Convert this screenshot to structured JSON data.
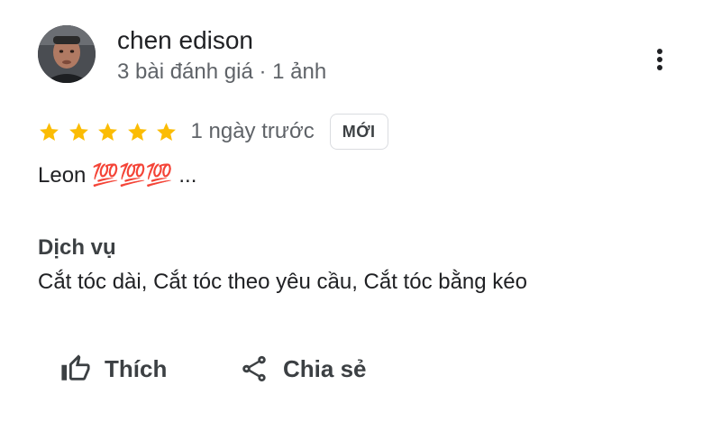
{
  "review": {
    "author": {
      "name": "chen edison",
      "meta": "3 bài đánh giá · 1 ảnh"
    },
    "rating": 5,
    "rating_max": 5,
    "date": "1 ngày trước",
    "badge": "MỚI",
    "text": "Leon 💯💯💯 ...",
    "services": {
      "heading": "Dịch vụ",
      "value": "Cắt tóc dài, Cắt tóc theo yêu cầu, Cắt tóc bằng kéo"
    }
  },
  "actions": {
    "like_label": "Thích",
    "share_label": "Chia sẻ"
  },
  "icons": {
    "more": "more-vertical-icon",
    "like": "thumb-up-icon",
    "share": "share-icon",
    "star": "star-icon"
  },
  "colors": {
    "star": "#fbbc04",
    "text": "#202124",
    "secondary_text": "#5f6368",
    "badge_border": "#dadce0"
  }
}
